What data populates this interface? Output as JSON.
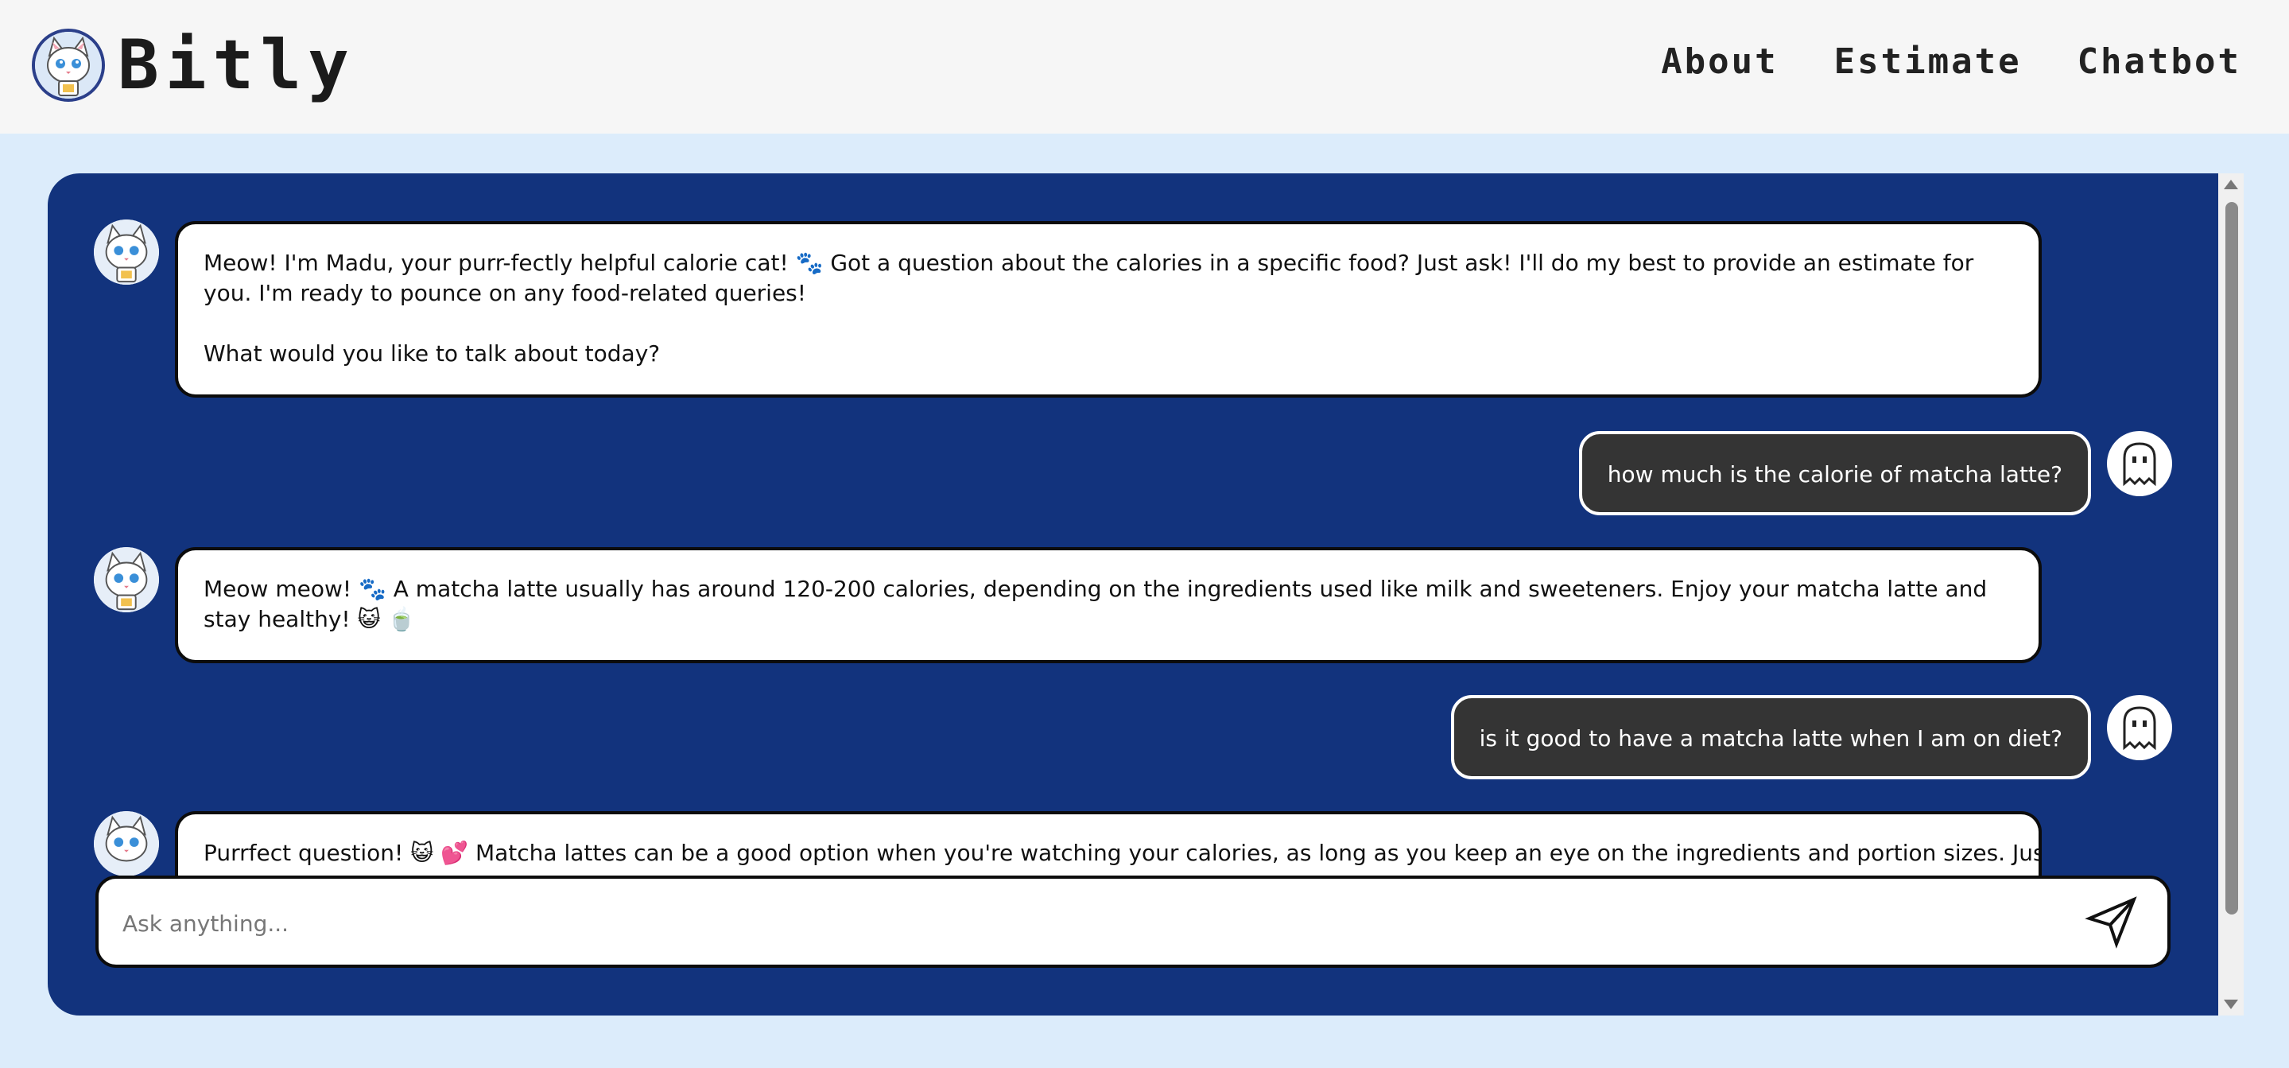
{
  "brand": {
    "name": "Bitly",
    "logo_icon": "cat-logo-icon"
  },
  "nav": {
    "items": [
      "About",
      "Estimate",
      "Chatbot"
    ]
  },
  "chat": {
    "messages": [
      {
        "role": "bot",
        "paragraphs": [
          "Meow! I'm Madu, your purr-fectly helpful calorie cat! 🐾 Got a question about the calories in a specific food? Just ask! I'll do my best to provide an estimate for you. I'm ready to pounce on any food-related queries!",
          "What would you like to talk about today?"
        ]
      },
      {
        "role": "user",
        "text": "how much is the calorie of matcha latte?"
      },
      {
        "role": "bot",
        "paragraphs": [
          "Meow meow! 🐾 A matcha latte usually has around 120-200 calories, depending on the ingredients used like milk and sweeteners. Enjoy your matcha latte and stay healthy! 😺 🍵"
        ]
      },
      {
        "role": "user",
        "text": "is it good to have a matcha latte when I am on diet?"
      },
      {
        "role": "bot",
        "paragraphs": [
          "Purrfect question! 😺 💕 Matcha lattes can be a good option when you're watching your calories, as long as you keep an eye on the ingredients and portion sizes. Just"
        ]
      }
    ],
    "bot_avatar_icon": "cat-avatar-icon",
    "user_avatar_icon": "ghost-avatar-icon"
  },
  "input": {
    "placeholder": "Ask anything...",
    "value": "",
    "send_icon": "send-arrow-icon"
  },
  "colors": {
    "panel": "#12337d",
    "page_bg": "#dcecfb",
    "user_bubble": "#343434",
    "header_bg": "#f6f6f6"
  }
}
